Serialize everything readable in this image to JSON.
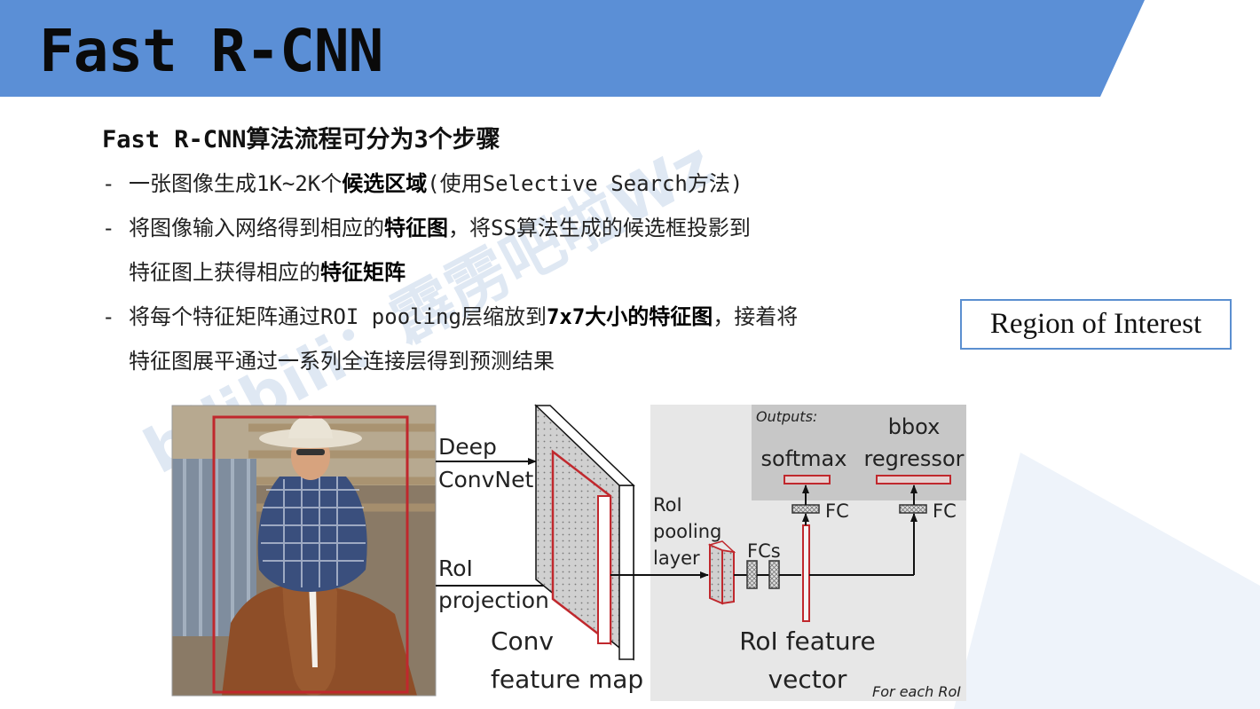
{
  "slide": {
    "title": "Fast R-CNN",
    "intro": "Fast R-CNN算法流程可分为3个步骤",
    "steps": [
      {
        "lines": [
          [
            {
              "t": "一张图像生成1K~2K个",
              "b": false
            },
            {
              "t": "候选区域",
              "b": true
            },
            {
              "t": "(使用Selective Search方法)",
              "b": false
            }
          ]
        ]
      },
      {
        "lines": [
          [
            {
              "t": "将图像输入网络得到相应的",
              "b": false
            },
            {
              "t": "特征图",
              "b": true
            },
            {
              "t": "，将SS算法生成的候选框投影到",
              "b": false
            }
          ],
          [
            {
              "t": "特征图上获得相应的",
              "b": false
            },
            {
              "t": "特征矩阵",
              "b": true
            }
          ]
        ]
      },
      {
        "lines": [
          [
            {
              "t": "将每个特征矩阵通过ROI pooling层缩放到",
              "b": false
            },
            {
              "t": "7x7大小的特征图",
              "b": true
            },
            {
              "t": "，接着将",
              "b": false
            }
          ],
          [
            {
              "t": "特征图展平通过一系列全连接层得到预测结果",
              "b": false
            }
          ]
        ]
      }
    ],
    "roi_box": "Region of Interest",
    "watermark": "bilibili：霹雳吧啦Wz"
  },
  "diagram": {
    "deep_convnet": [
      "Deep",
      "ConvNet"
    ],
    "roi_projection": [
      "RoI",
      "projection"
    ],
    "conv_feature_map": [
      "Conv",
      "feature map"
    ],
    "roi_pooling_layer": [
      "RoI",
      "pooling",
      "layer"
    ],
    "fcs": "FCs",
    "roi_feature_vector": [
      "RoI feature",
      "vector"
    ],
    "outputs": "Outputs:",
    "softmax": "softmax",
    "bbox_regressor": [
      "bbox",
      "regressor"
    ],
    "fc": "FC",
    "for_each_roi": "For each RoI"
  },
  "colors": {
    "header_band": "#5b8fd6",
    "accent_red": "#c0282d",
    "roi_box_border": "#5b8fd0",
    "diagram_panel": "#e7e7e7",
    "outputs_panel": "#c7c7c7"
  }
}
